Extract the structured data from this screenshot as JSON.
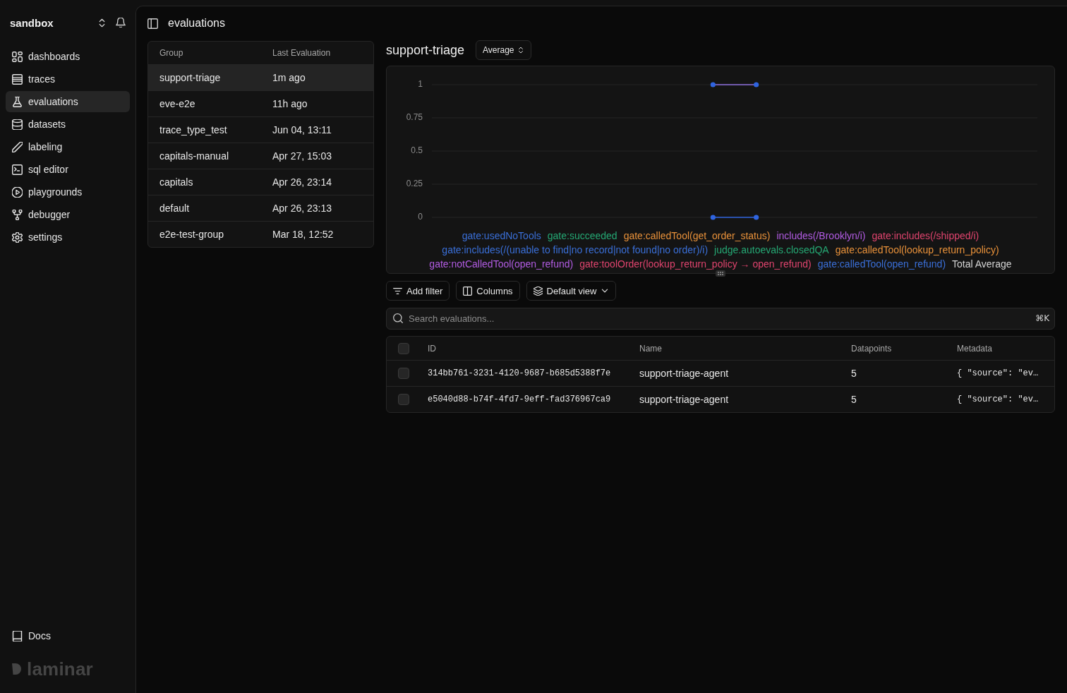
{
  "sidebar": {
    "workspace": "sandbox",
    "items": [
      {
        "label": "dashboards",
        "selected": false
      },
      {
        "label": "traces",
        "selected": false
      },
      {
        "label": "evaluations",
        "selected": true
      },
      {
        "label": "datasets",
        "selected": false
      },
      {
        "label": "labeling",
        "selected": false
      },
      {
        "label": "sql editor",
        "selected": false
      },
      {
        "label": "playgrounds",
        "selected": false
      },
      {
        "label": "debugger",
        "selected": false
      },
      {
        "label": "settings",
        "selected": false
      }
    ],
    "footer_link": "Docs",
    "logo": "laminar"
  },
  "header": {
    "title": "evaluations"
  },
  "groups_table": {
    "columns": [
      "Group",
      "Last Evaluation"
    ],
    "rows": [
      {
        "group": "support-triage",
        "last_evaluation": "1m ago",
        "selected": true
      },
      {
        "group": "eve-e2e",
        "last_evaluation": "11h ago",
        "selected": false
      },
      {
        "group": "trace_type_test",
        "last_evaluation": "Jun 04, 13:11",
        "selected": false
      },
      {
        "group": "capitals-manual",
        "last_evaluation": "Apr 27, 15:03",
        "selected": false
      },
      {
        "group": "capitals",
        "last_evaluation": "Apr 26, 23:14",
        "selected": false
      },
      {
        "group": "default",
        "last_evaluation": "Apr 26, 23:13",
        "selected": false
      },
      {
        "group": "e2e-test-group",
        "last_evaluation": "Mar 18, 12:52",
        "selected": false
      }
    ]
  },
  "chart_panel": {
    "title": "support-triage",
    "aggregation": "Average",
    "chart_data": [
      {
        "type": "line",
        "categories": [
          null,
          null,
          null,
          null,
          null,
          null,
          null,
          null,
          null,
          null,
          null,
          null,
          null,
          null
        ],
        "yticks": [
          0,
          0.25,
          0.5,
          0.75,
          1
        ],
        "ylim": [
          0,
          1
        ],
        "tick_labels": "y",
        "grid": true,
        "series": [
          {
            "type": "line",
            "color": "#8e6fdc",
            "marker": "none",
            "values": [
              null,
              null,
              null,
              null,
              null,
              null,
              1,
              1,
              null,
              null,
              null,
              null,
              null,
              null
            ]
          },
          {
            "type": "scatter",
            "color": "#2f64e0",
            "marker": "circle",
            "values": [
              null,
              null,
              null,
              null,
              null,
              null,
              1,
              1,
              null,
              null,
              null,
              null,
              null,
              null
            ]
          },
          {
            "type": "line",
            "color": "#2f64e0",
            "marker": "circle",
            "values": [
              null,
              null,
              null,
              null,
              null,
              null,
              0,
              0,
              null,
              null,
              null,
              null,
              null,
              null
            ]
          }
        ]
      }
    ],
    "legend_items": [
      {
        "label": "gate:usedNoTools",
        "color": "#3a6fd8"
      },
      {
        "label": "gate:succeeded",
        "color": "#25a874"
      },
      {
        "label": "gate:calledTool(get_order_status)",
        "color": "#e8913a"
      },
      {
        "label": "includes(/Brooklyn/i)",
        "color": "#b25ce3"
      },
      {
        "label": "gate:includes(/shipped/i)",
        "color": "#e0446e"
      },
      {
        "label": "gate:includes(/(unable to find|no record|not found|no order)/i)",
        "color": "#3a6fd8"
      },
      {
        "label": "judge.autoevals.closedQA",
        "color": "#25a874"
      },
      {
        "label": "gate:calledTool(lookup_return_policy)",
        "color": "#e8913a"
      },
      {
        "label": "gate:notCalledTool(open_refund)",
        "color": "#b25ce3"
      },
      {
        "label": "gate:toolOrder(lookup_return_policy → open_refund)",
        "color": "#e0446e"
      },
      {
        "label": "gate:calledTool(open_refund)",
        "color": "#3a6fd8"
      },
      {
        "label": "Total Average",
        "color": "#d4d4d4"
      }
    ]
  },
  "toolbar": {
    "buttons": [
      "Add filter",
      "Columns",
      "Default view"
    ]
  },
  "search": {
    "placeholder": "Search evaluations...",
    "shortcut": "⌘K"
  },
  "evaluations_table": {
    "select_all_checked": false,
    "columns": [
      "ID",
      "Name",
      "Datapoints",
      "Metadata"
    ],
    "rows": [
      {
        "checked": false,
        "id": "314bb761-3231-4120-9687-b685d5388f7e",
        "name": "support-triage-agent",
        "datapoints": "5",
        "metadata": "{ \"source\": \"ev…"
      },
      {
        "checked": false,
        "id": "e5040d88-b74f-4fd7-9eff-fad376967ca9",
        "name": "support-triage-agent",
        "datapoints": "5",
        "metadata": "{ \"source\": \"ev…"
      }
    ]
  }
}
